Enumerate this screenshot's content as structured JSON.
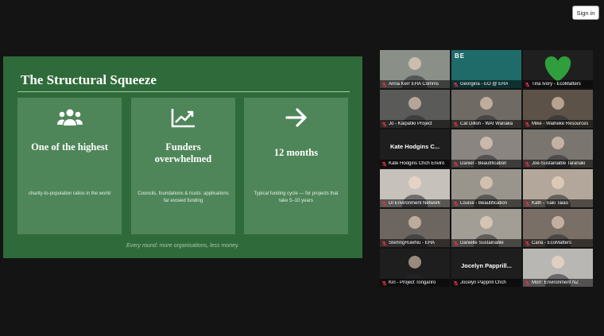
{
  "header": {
    "signin_label": "Sign in"
  },
  "slide": {
    "title": "The Structural Squeeze",
    "footer": "Every round: more organisations, less money.",
    "cards": [
      {
        "icon": "users-icon",
        "head": "One of the highest",
        "sub": "charity-to-population ratios in the world"
      },
      {
        "icon": "trend-up-icon",
        "head": "Funders overwhelmed",
        "sub": "Councils, foundations & trusts: applications far exceed funding"
      },
      {
        "icon": "arrow-right-icon",
        "head": "12 months",
        "sub": "Typical funding cycle — for projects that take 5–10 years"
      }
    ]
  },
  "participants": [
    {
      "name": "Anna Kerr EHA Comms",
      "bg": "#8a8f88"
    },
    {
      "name": "Georgina - EO @ EHA",
      "bg": "#1e6b6a",
      "logo": "BE"
    },
    {
      "name": "Tina Ivory - EcoMatters",
      "bg": "#1f1f1f",
      "heart": true
    },
    {
      "name": "Jo - Kaipātiki Project",
      "bg": "#5a5a58",
      "active": true
    },
    {
      "name": "Cat Dillon - WAI Wānaka",
      "bg": "#6f6a64"
    },
    {
      "name": "Mike - Waiheke Resources",
      "bg": "#5c5248"
    },
    {
      "name": "Kate Hodgins Chch Enviro",
      "bg": "#1e1e1e",
      "avatar": "Kate Hodgins C..."
    },
    {
      "name": "Daniel - Beautification",
      "bg": "#8a8580"
    },
    {
      "name": "Joe-Sustainable Taranaki",
      "bg": "#7a766f"
    },
    {
      "name": "DI Environment Network",
      "bg": "#c6c2bb"
    },
    {
      "name": "Louise - Beautification",
      "bg": "#9a958c"
    },
    {
      "name": "Kath - Tiaki Taiao",
      "bg": "#b2a79a"
    },
    {
      "name": "SterlingRuwhiu - EHA",
      "bg": "#6d6660"
    },
    {
      "name": "Danielle Sustainable",
      "bg": "#a29d95"
    },
    {
      "name": "Carla - EcoMatters",
      "bg": "#7a6f66"
    },
    {
      "name": "Kiri - Project Tongariro",
      "bg": "#1e1e1e",
      "photo": true
    },
    {
      "name": "Jocelyn Papprill Chch",
      "bg": "#1e1e1e",
      "avatar": "Jocelyn Papprill..."
    },
    {
      "name": "Morr: Environment NZ",
      "bg": "#b9b7b3"
    }
  ]
}
